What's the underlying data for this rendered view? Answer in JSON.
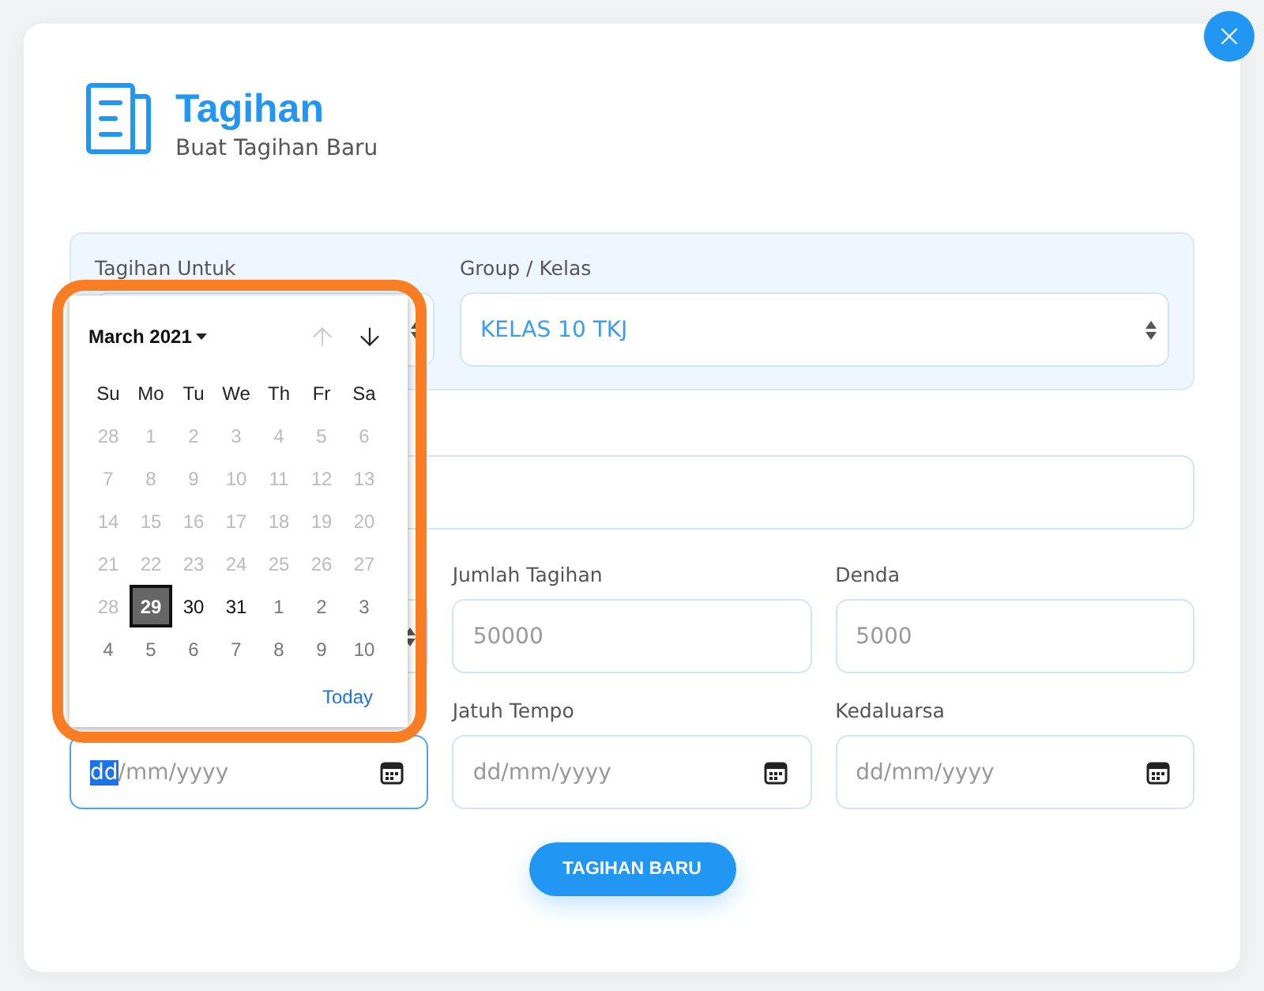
{
  "header": {
    "title": "Tagihan",
    "subtitle": "Buat Tagihan Baru"
  },
  "target_panel": {
    "fields": [
      {
        "kind": "select",
        "label": "Tagihan Untuk"
      },
      {
        "kind": "select",
        "label": "Group / Kelas",
        "value": "KELAS 10 TKJ"
      }
    ]
  },
  "description_field": {
    "kind": "text"
  },
  "rows": [
    {
      "fields": [
        {
          "kind": "select"
        },
        {
          "kind": "text",
          "label": "Jumlah Tagihan",
          "placeholder": "50000"
        },
        {
          "kind": "text",
          "label": "Denda",
          "placeholder": "5000"
        }
      ]
    },
    {
      "fields": [
        {
          "kind": "date",
          "placeholder": "dd/mm/yyyy",
          "focused": true
        },
        {
          "kind": "date",
          "label": "Jatuh Tempo",
          "placeholder": "dd/mm/yyyy",
          "focused": false
        },
        {
          "kind": "date",
          "label": "Kedaluarsa",
          "placeholder": "dd/mm/yyyy",
          "focused": false
        }
      ]
    }
  ],
  "submit_button": "TAGIHAN BARU",
  "date_picker": {
    "month": "March 2021",
    "prev_disabled": true,
    "next_disabled": false,
    "weekdays": [
      "Su",
      "Mo",
      "Tu",
      "We",
      "Th",
      "Fr",
      "Sa"
    ],
    "weeks": [
      [
        {
          "day": "28",
          "kind": "disabled",
          "selected": false
        },
        {
          "day": "1",
          "kind": "disabled",
          "selected": false
        },
        {
          "day": "2",
          "kind": "disabled",
          "selected": false
        },
        {
          "day": "3",
          "kind": "disabled",
          "selected": false
        },
        {
          "day": "4",
          "kind": "disabled",
          "selected": false
        },
        {
          "day": "5",
          "kind": "disabled",
          "selected": false
        },
        {
          "day": "6",
          "kind": "disabled",
          "selected": false
        }
      ],
      [
        {
          "day": "7",
          "kind": "disabled",
          "selected": false
        },
        {
          "day": "8",
          "kind": "disabled",
          "selected": false
        },
        {
          "day": "9",
          "kind": "disabled",
          "selected": false
        },
        {
          "day": "10",
          "kind": "disabled",
          "selected": false
        },
        {
          "day": "11",
          "kind": "disabled",
          "selected": false
        },
        {
          "day": "12",
          "kind": "disabled",
          "selected": false
        },
        {
          "day": "13",
          "kind": "disabled",
          "selected": false
        }
      ],
      [
        {
          "day": "14",
          "kind": "disabled",
          "selected": false
        },
        {
          "day": "15",
          "kind": "disabled",
          "selected": false
        },
        {
          "day": "16",
          "kind": "disabled",
          "selected": false
        },
        {
          "day": "17",
          "kind": "disabled",
          "selected": false
        },
        {
          "day": "18",
          "kind": "disabled",
          "selected": false
        },
        {
          "day": "19",
          "kind": "disabled",
          "selected": false
        },
        {
          "day": "20",
          "kind": "disabled",
          "selected": false
        }
      ],
      [
        {
          "day": "21",
          "kind": "disabled",
          "selected": false
        },
        {
          "day": "22",
          "kind": "disabled",
          "selected": false
        },
        {
          "day": "23",
          "kind": "disabled",
          "selected": false
        },
        {
          "day": "24",
          "kind": "disabled",
          "selected": false
        },
        {
          "day": "25",
          "kind": "disabled",
          "selected": false
        },
        {
          "day": "26",
          "kind": "disabled",
          "selected": false
        },
        {
          "day": "27",
          "kind": "disabled",
          "selected": false
        }
      ],
      [
        {
          "day": "28",
          "kind": "disabled",
          "selected": false
        },
        {
          "day": "29",
          "kind": "current",
          "selected": true
        },
        {
          "day": "30",
          "kind": "current",
          "selected": false
        },
        {
          "day": "31",
          "kind": "current",
          "selected": false
        },
        {
          "day": "1",
          "kind": "other",
          "selected": false
        },
        {
          "day": "2",
          "kind": "other",
          "selected": false
        },
        {
          "day": "3",
          "kind": "other",
          "selected": false
        }
      ],
      [
        {
          "day": "4",
          "kind": "other",
          "selected": false
        },
        {
          "day": "5",
          "kind": "other",
          "selected": false
        },
        {
          "day": "6",
          "kind": "other",
          "selected": false
        },
        {
          "day": "7",
          "kind": "other",
          "selected": false
        },
        {
          "day": "8",
          "kind": "other",
          "selected": false
        },
        {
          "day": "9",
          "kind": "other",
          "selected": false
        },
        {
          "day": "10",
          "kind": "other",
          "selected": false
        }
      ]
    ],
    "today_link": "Today"
  }
}
